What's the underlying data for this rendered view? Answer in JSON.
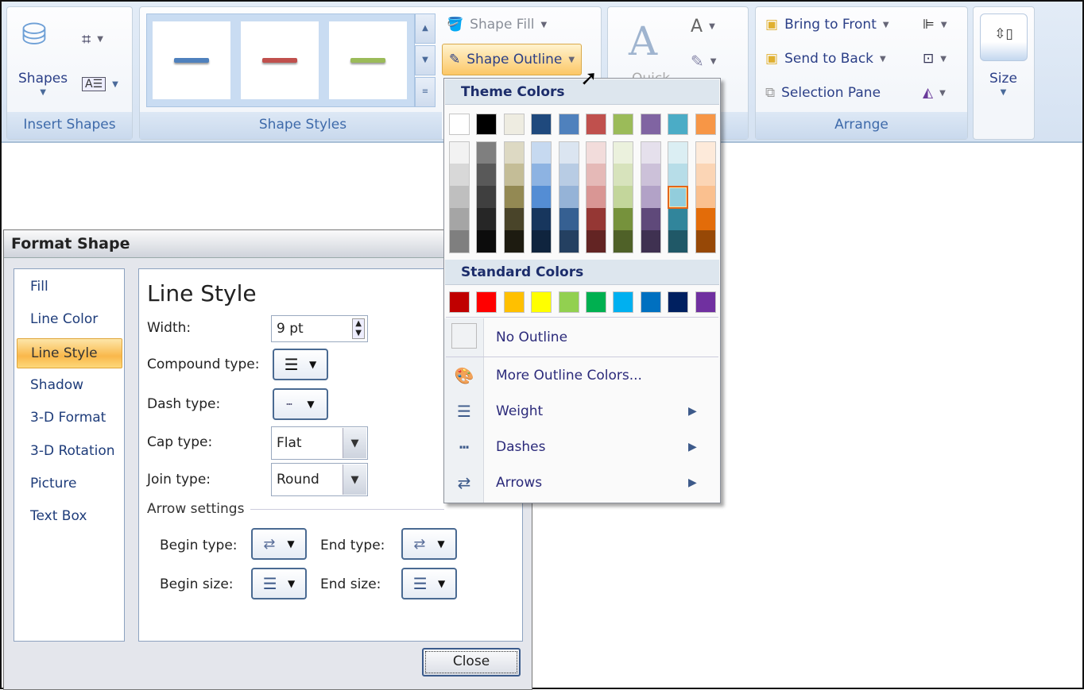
{
  "ribbon": {
    "insert_shapes": {
      "label": "Insert Shapes",
      "shapes_label": "Shapes"
    },
    "shape_styles": {
      "label": "Shape Styles",
      "gallery": [
        "#4f81bd",
        "#c0504d",
        "#9bbb59"
      ],
      "shape_fill": "Shape Fill",
      "shape_outline": "Shape Outline"
    },
    "wordart": {
      "quick_styles": "Quick"
    },
    "arrange": {
      "label": "Arrange",
      "bring_to_front": "Bring to Front",
      "send_to_back": "Send to Back",
      "selection_pane": "Selection Pane"
    },
    "size": {
      "label": "Size"
    }
  },
  "outline_menu": {
    "theme_header": "Theme Colors",
    "theme_colors": [
      "#ffffff",
      "#000000",
      "#eeece1",
      "#1f497d",
      "#4f81bd",
      "#c0504d",
      "#9bbb59",
      "#8064a2",
      "#4bacc6",
      "#f79646"
    ],
    "theme_shades": [
      [
        "#f2f2f2",
        "#d8d8d8",
        "#bfbfbf",
        "#a5a5a5",
        "#7f7f7f"
      ],
      [
        "#7f7f7f",
        "#595959",
        "#3f3f3f",
        "#262626",
        "#0c0c0c"
      ],
      [
        "#ddd9c3",
        "#c4bd97",
        "#938953",
        "#494429",
        "#1d1b10"
      ],
      [
        "#c6d9f0",
        "#8db3e2",
        "#548dd4",
        "#17365d",
        "#0f243e"
      ],
      [
        "#dbe5f1",
        "#b8cce4",
        "#95b3d7",
        "#366092",
        "#244061"
      ],
      [
        "#f2dcdb",
        "#e5b9b7",
        "#d99694",
        "#953734",
        "#632423"
      ],
      [
        "#ebf1dd",
        "#d7e3bc",
        "#c3d69b",
        "#76923c",
        "#4f6128"
      ],
      [
        "#e5e0ec",
        "#ccc1d9",
        "#b2a2c7",
        "#5f497a",
        "#3f3151"
      ],
      [
        "#dbeef3",
        "#b7dde8",
        "#92cddc",
        "#31859b",
        "#205867"
      ],
      [
        "#fdeada",
        "#fbd5b5",
        "#fac08f",
        "#e36c09",
        "#974806"
      ]
    ],
    "selected": {
      "column": 8,
      "shade": 2
    },
    "standard_header": "Standard Colors",
    "standard_colors": [
      "#c00000",
      "#ff0000",
      "#ffc000",
      "#ffff00",
      "#92d050",
      "#00b050",
      "#00b0f0",
      "#0070c0",
      "#002060",
      "#7030a0"
    ],
    "no_outline": "No Outline",
    "more_colors": "More Outline Colors...",
    "weight": "Weight",
    "dashes": "Dashes",
    "arrows": "Arrows"
  },
  "dialog": {
    "title": "Format Shape",
    "nav": [
      "Fill",
      "Line Color",
      "Line Style",
      "Shadow",
      "3-D Format",
      "3-D Rotation",
      "Picture",
      "Text Box"
    ],
    "selected_nav": "Line Style",
    "heading": "Line Style",
    "width_label": "Width:",
    "width_value": "9 pt",
    "compound_label": "Compound type:",
    "dash_label": "Dash type:",
    "cap_label": "Cap type:",
    "cap_value": "Flat",
    "join_label": "Join type:",
    "join_value": "Round",
    "arrow_settings": "Arrow settings",
    "begin_type": "Begin type:",
    "end_type": "End type:",
    "begin_size": "Begin size:",
    "end_size": "End size:",
    "close": "Close"
  }
}
